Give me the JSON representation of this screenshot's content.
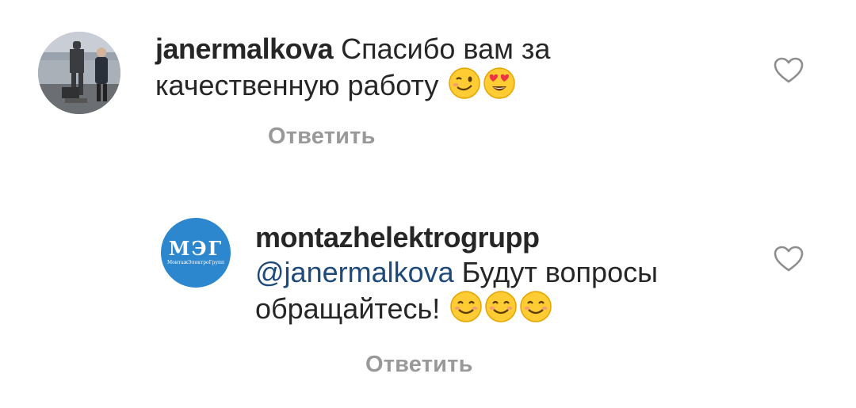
{
  "comments": [
    {
      "username": "janermalkova",
      "text": "Спасибо вам за качественную работу",
      "emoji_icons": [
        "winking-face-icon",
        "heart-eyes-face-icon"
      ],
      "reply_label": "Ответить"
    },
    {
      "username": "montazhelektrogrupp",
      "avatar_logo_text": "МЭГ",
      "avatar_logo_subtext": "МонтажЭлектроГрупп",
      "mention": "@janermalkova",
      "text": "Будут вопросы обращайтесь!",
      "emoji_icons": [
        "smiling-face-icon",
        "smiling-face-icon",
        "smiling-face-icon"
      ],
      "reply_label": "Ответить"
    }
  ],
  "colors": {
    "text": "#262626",
    "mention": "#1d4a7a",
    "reply": "#999999",
    "logo_blue": "#2c87cf",
    "heart_outline": "#8e8e8e"
  }
}
